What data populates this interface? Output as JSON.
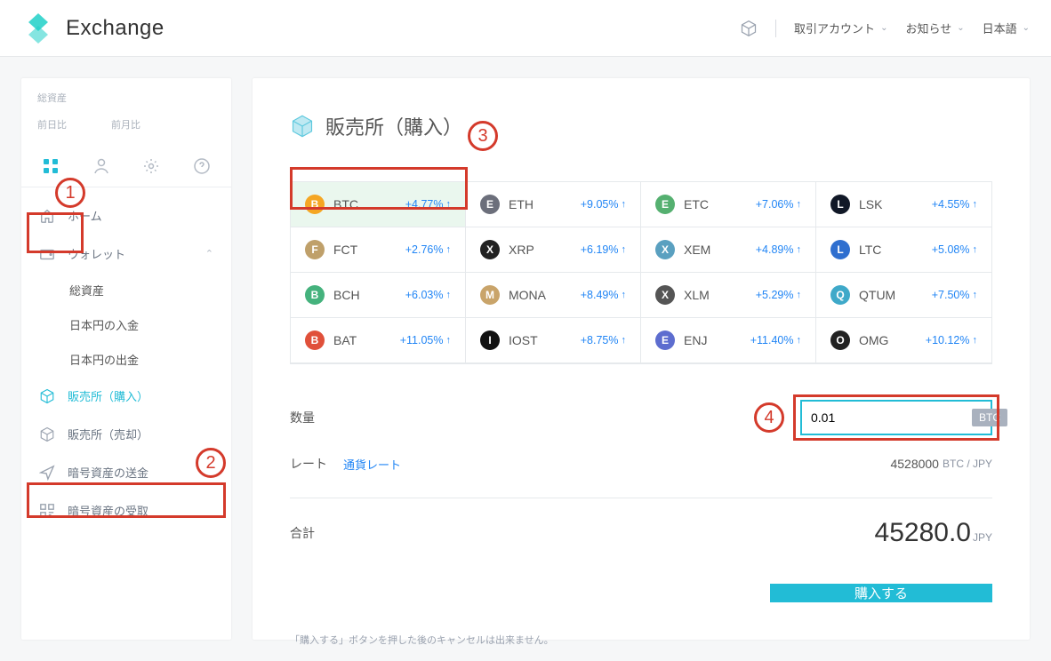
{
  "brand": {
    "name": "Exchange"
  },
  "header": {
    "account": "取引アカウント",
    "notice": "お知らせ",
    "lang": "日本語"
  },
  "sidebar": {
    "assets_label": "総資産",
    "prev_day": "前日比",
    "prev_month": "前月比",
    "home": "ホーム",
    "wallet": "ウォレット",
    "sub_assets": "総資産",
    "sub_deposit": "日本円の入金",
    "sub_withdraw": "日本円の出金",
    "buy": "販売所（購入）",
    "sell": "販売所（売却）",
    "send": "暗号資産の送金",
    "receive": "暗号資産の受取"
  },
  "page": {
    "title": "販売所（購入）",
    "qty_label": "数量",
    "rate_label": "レート",
    "rate_link": "通貨レート",
    "rate_value": "4528000",
    "rate_pair": "BTC / JPY",
    "total_label": "合計",
    "total_value": "45280.0",
    "total_unit": "JPY",
    "buy_btn": "購入する",
    "note": "「購入する」ボタンを押した後のキャンセルは出来ません。",
    "qty_value": "0.01",
    "qty_unit": "BTC"
  },
  "coins": [
    {
      "sym": "BTC",
      "chg": "+4.77%",
      "color": "#f5a623",
      "selected": true
    },
    {
      "sym": "ETH",
      "chg": "+9.05%",
      "color": "#6c6f7b"
    },
    {
      "sym": "ETC",
      "chg": "+7.06%",
      "color": "#55b070"
    },
    {
      "sym": "LSK",
      "chg": "+4.55%",
      "color": "#111827"
    },
    {
      "sym": "FCT",
      "chg": "+2.76%",
      "color": "#bfa06a"
    },
    {
      "sym": "XRP",
      "chg": "+6.19%",
      "color": "#222222"
    },
    {
      "sym": "XEM",
      "chg": "+4.89%",
      "color": "#5aa0c0"
    },
    {
      "sym": "LTC",
      "chg": "+5.08%",
      "color": "#2f6fcf"
    },
    {
      "sym": "BCH",
      "chg": "+6.03%",
      "color": "#45b27d"
    },
    {
      "sym": "MONA",
      "chg": "+8.49%",
      "color": "#c9a46a"
    },
    {
      "sym": "XLM",
      "chg": "+5.29%",
      "color": "#555555"
    },
    {
      "sym": "QTUM",
      "chg": "+7.50%",
      "color": "#3fa9c9"
    },
    {
      "sym": "BAT",
      "chg": "+11.05%",
      "color": "#e0503a"
    },
    {
      "sym": "IOST",
      "chg": "+8.75%",
      "color": "#111111"
    },
    {
      "sym": "ENJ",
      "chg": "+11.40%",
      "color": "#5d6dcf"
    },
    {
      "sym": "OMG",
      "chg": "+10.12%",
      "color": "#222222"
    }
  ],
  "annotations": {
    "n1": "1",
    "n2": "2",
    "n3": "3",
    "n4": "4"
  }
}
